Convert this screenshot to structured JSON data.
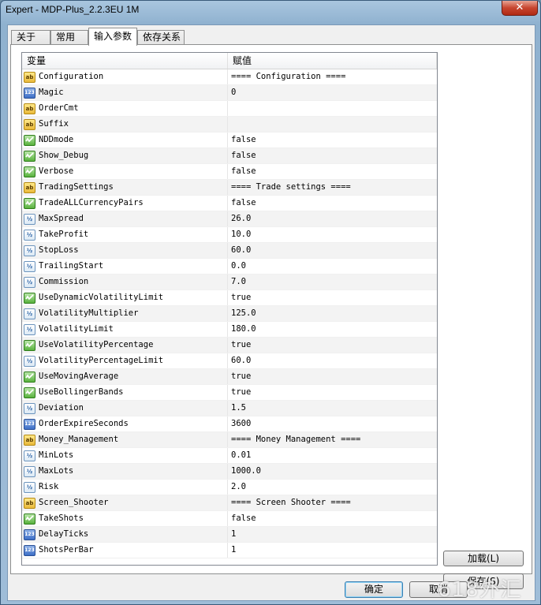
{
  "window": {
    "title": "Expert - MDP-Plus_2.2.3EU 1M",
    "close_glyph": "✕"
  },
  "tabs": [
    {
      "label": "关于"
    },
    {
      "label": "常用"
    },
    {
      "label": "输入参数",
      "active": true
    },
    {
      "label": "依存关系"
    }
  ],
  "grid": {
    "columns": [
      "变量",
      "赋值"
    ],
    "rows": [
      {
        "type": "string",
        "name": "Configuration",
        "value": "==== Configuration ===="
      },
      {
        "type": "int",
        "name": "Magic",
        "value": "0"
      },
      {
        "type": "string",
        "name": "OrderCmt",
        "value": ""
      },
      {
        "type": "string",
        "name": "Suffix",
        "value": ""
      },
      {
        "type": "bool",
        "name": "NDDmode",
        "value": "false"
      },
      {
        "type": "bool",
        "name": "Show_Debug",
        "value": "false"
      },
      {
        "type": "bool",
        "name": "Verbose",
        "value": "false"
      },
      {
        "type": "string",
        "name": "TradingSettings",
        "value": "==== Trade settings ===="
      },
      {
        "type": "bool",
        "name": "TradeALLCurrencyPairs",
        "value": "false"
      },
      {
        "type": "double",
        "name": "MaxSpread",
        "value": "26.0"
      },
      {
        "type": "double",
        "name": "TakeProfit",
        "value": "10.0"
      },
      {
        "type": "double",
        "name": "StopLoss",
        "value": "60.0"
      },
      {
        "type": "double",
        "name": "TrailingStart",
        "value": "0.0"
      },
      {
        "type": "double",
        "name": "Commission",
        "value": "7.0"
      },
      {
        "type": "bool",
        "name": "UseDynamicVolatilityLimit",
        "value": "true"
      },
      {
        "type": "double",
        "name": "VolatilityMultiplier",
        "value": "125.0"
      },
      {
        "type": "double",
        "name": "VolatilityLimit",
        "value": "180.0"
      },
      {
        "type": "bool",
        "name": "UseVolatilityPercentage",
        "value": "true"
      },
      {
        "type": "double",
        "name": "VolatilityPercentageLimit",
        "value": "60.0"
      },
      {
        "type": "bool",
        "name": "UseMovingAverage",
        "value": "true"
      },
      {
        "type": "bool",
        "name": "UseBollingerBands",
        "value": "true"
      },
      {
        "type": "double",
        "name": "Deviation",
        "value": "1.5"
      },
      {
        "type": "int",
        "name": "OrderExpireSeconds",
        "value": "3600"
      },
      {
        "type": "string",
        "name": "Money_Management",
        "value": "==== Money Management ===="
      },
      {
        "type": "double",
        "name": "MinLots",
        "value": "0.01"
      },
      {
        "type": "double",
        "name": "MaxLots",
        "value": "1000.0"
      },
      {
        "type": "double",
        "name": "Risk",
        "value": "2.0"
      },
      {
        "type": "string",
        "name": "Screen_Shooter",
        "value": "==== Screen Shooter ===="
      },
      {
        "type": "bool",
        "name": "TakeShots",
        "value": "false"
      },
      {
        "type": "int",
        "name": "DelayTicks",
        "value": "1"
      },
      {
        "type": "int",
        "name": "ShotsPerBar",
        "value": "1"
      }
    ]
  },
  "icons": {
    "string": "ab",
    "int": "123",
    "double": "½",
    "bool": "check"
  },
  "buttons": {
    "load": "加载(L)",
    "save": "保存(S)",
    "ok": "确定",
    "cancel": "取消"
  },
  "watermark": "618外汇网"
}
